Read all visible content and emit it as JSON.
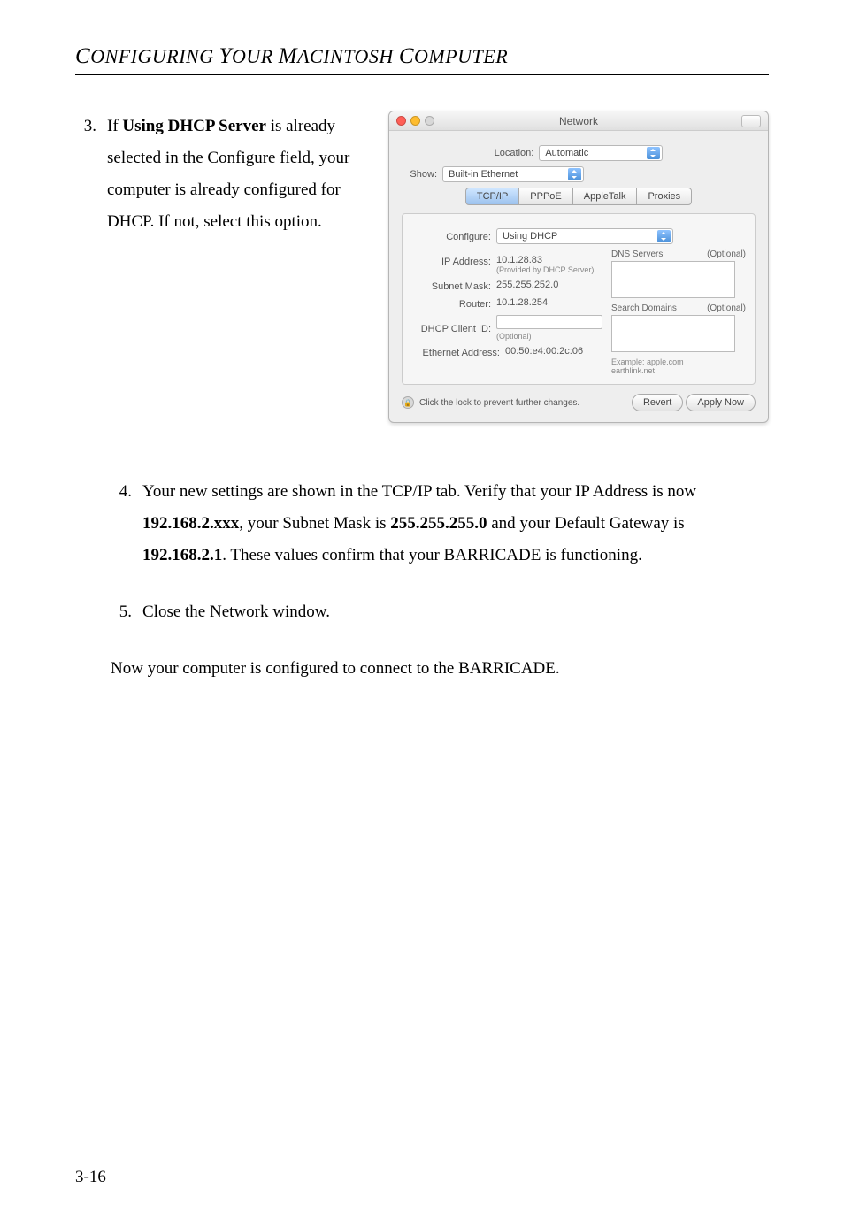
{
  "page_heading": "CONFIGURING YOUR MACINTOSH COMPUTER",
  "step3": {
    "num": "3.",
    "prefix": "If ",
    "bold": "Using DHCP Server",
    "suffix": " is already selected in the Configure field, your computer is already configured for DHCP. If not, select this option."
  },
  "window": {
    "title": "Network",
    "location_label": "Location:",
    "location_value": "Automatic",
    "show_label": "Show:",
    "show_value": "Built-in Ethernet",
    "tabs": [
      "TCP/IP",
      "PPPoE",
      "AppleTalk",
      "Proxies"
    ],
    "configure_label": "Configure:",
    "configure_value": "Using DHCP",
    "ip_label": "IP Address:",
    "ip_value": "10.1.28.83",
    "ip_sub": "(Provided by DHCP Server)",
    "subnet_label": "Subnet Mask:",
    "subnet_value": "255.255.252.0",
    "router_label": "Router:",
    "router_value": "10.1.28.254",
    "dhcp_client_label": "DHCP Client ID:",
    "dhcp_client_sub": "(Optional)",
    "eth_label": "Ethernet Address:",
    "eth_value": "00:50:e4:00:2c:06",
    "dns_label": "DNS Servers",
    "search_label": "Search Domains",
    "optional": "(Optional)",
    "example_label": "Example:",
    "example_value": "apple.com\nearthlink.net",
    "lock_text": "Click the lock to prevent further changes.",
    "revert": "Revert",
    "apply": "Apply Now"
  },
  "step4": {
    "num": "4.",
    "t1": "Your new settings are shown in the TCP/IP tab. Verify that your IP Address is now ",
    "b1": "192.168.2.xxx",
    "t2": ", your Subnet Mask is ",
    "b2": "255.255.255.0",
    "t3": " and your Default Gateway is ",
    "b3": "192.168.2.1",
    "t4": ". These values confirm that your BARRICADE is functioning."
  },
  "step5": {
    "num": "5.",
    "text": "Close the Network window."
  },
  "final": "Now your computer is configured to connect to the BARRICADE.",
  "page_number": "3-16"
}
